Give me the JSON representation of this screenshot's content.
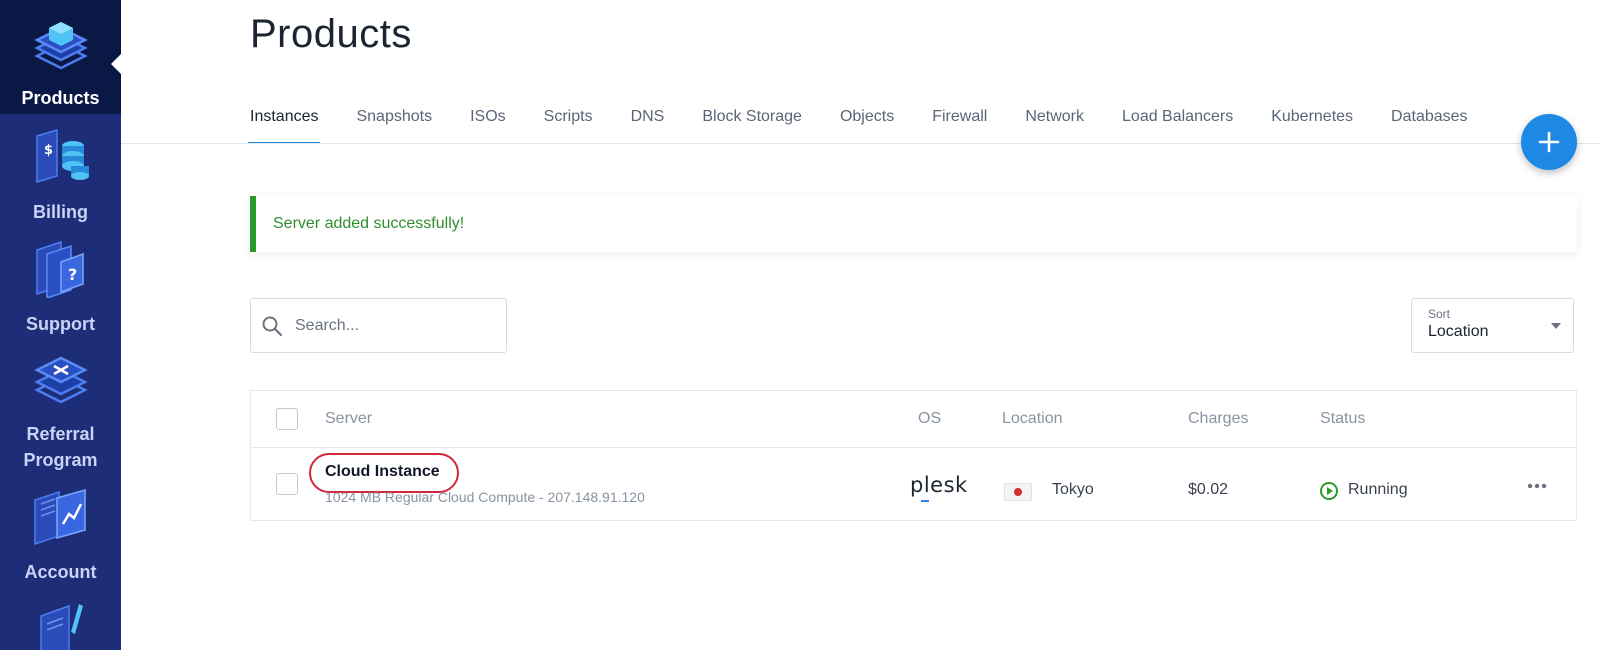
{
  "sidebar": {
    "items": [
      {
        "label": "Products",
        "icon": "layers-cube-icon"
      },
      {
        "label": "Billing",
        "icon": "billing-coins-icon"
      },
      {
        "label": "Support",
        "icon": "support-question-icon"
      },
      {
        "label": "Referral Program",
        "icon": "referral-layers-icon"
      },
      {
        "label": "Account",
        "icon": "account-chart-icon"
      }
    ]
  },
  "page": {
    "title": "Products"
  },
  "tabs": [
    "Instances",
    "Snapshots",
    "ISOs",
    "Scripts",
    "DNS",
    "Block Storage",
    "Objects",
    "Firewall",
    "Network",
    "Load Balancers",
    "Kubernetes",
    "Databases"
  ],
  "alert": {
    "message": "Server added successfully!"
  },
  "search": {
    "placeholder": "Search..."
  },
  "sort": {
    "label": "Sort",
    "value": "Location"
  },
  "table": {
    "headers": {
      "server": "Server",
      "os": "OS",
      "location": "Location",
      "charges": "Charges",
      "status": "Status"
    },
    "rows": [
      {
        "name": "Cloud Instance",
        "subtitle": "1024 MB Regular Cloud Compute - 207.148.91.120",
        "os": "plesk",
        "location": "Tokyo",
        "charges": "$0.02",
        "status": "Running"
      }
    ]
  },
  "colors": {
    "sidebar": "#1e2d78",
    "sidebar_active": "#0a1846",
    "accent": "#1e88e5",
    "success": "#2b9a2b",
    "highlight": "#d0283a"
  }
}
